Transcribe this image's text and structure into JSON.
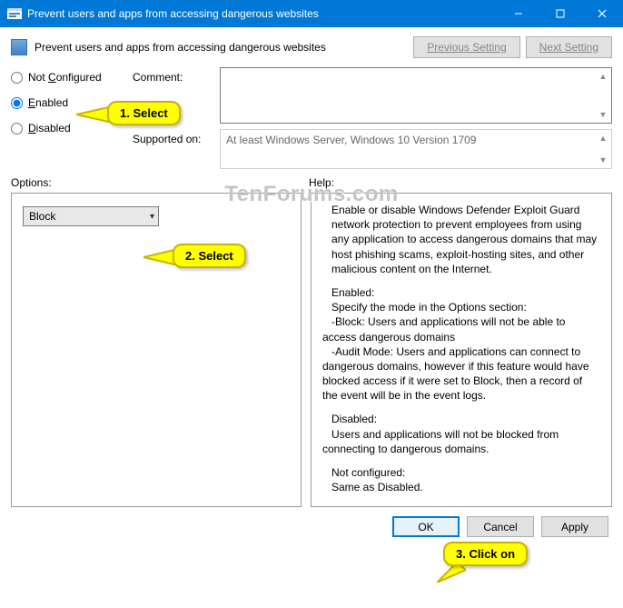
{
  "titlebar": {
    "title": "Prevent users and apps from accessing dangerous websites"
  },
  "header": {
    "policy_title": "Prevent users and apps from accessing dangerous websites",
    "prev": "Previous Setting",
    "next": "Next Setting"
  },
  "state": {
    "not_configured": "Not Configured",
    "enabled": "Enabled",
    "disabled": "Disabled",
    "selected": "enabled"
  },
  "fields": {
    "comment_label": "Comment:",
    "comment_value": "",
    "supported_label": "Supported on:",
    "supported_value": "At least Windows Server, Windows 10 Version 1709"
  },
  "labels": {
    "options": "Options:",
    "help": "Help:"
  },
  "options": {
    "dropdown_value": "Block"
  },
  "help": {
    "p1": "Enable or disable Windows Defender Exploit Guard network protection to prevent employees from using any application to access dangerous domains that may host phishing scams, exploit-hosting sites, and other malicious content on the Internet.",
    "enabled_h": "Enabled:",
    "enabled_l1": "Specify the mode in the Options section:",
    "enabled_l2": "-Block: Users and applications will not be able to access dangerous domains",
    "enabled_l3": "-Audit Mode: Users and applications can connect to dangerous domains, however if this feature would have blocked access if it were set to Block, then a record of the event will be in the event logs.",
    "disabled_h": "Disabled:",
    "disabled_l1": "Users and applications will not be blocked from connecting to dangerous domains.",
    "nc_h": "Not configured:",
    "nc_l1": "Same as Disabled."
  },
  "buttons": {
    "ok": "OK",
    "cancel": "Cancel",
    "apply": "Apply"
  },
  "annotations": {
    "a1": "1. Select",
    "a2": "2. Select",
    "a3": "3. Click on"
  },
  "watermark": "TenForums.com"
}
